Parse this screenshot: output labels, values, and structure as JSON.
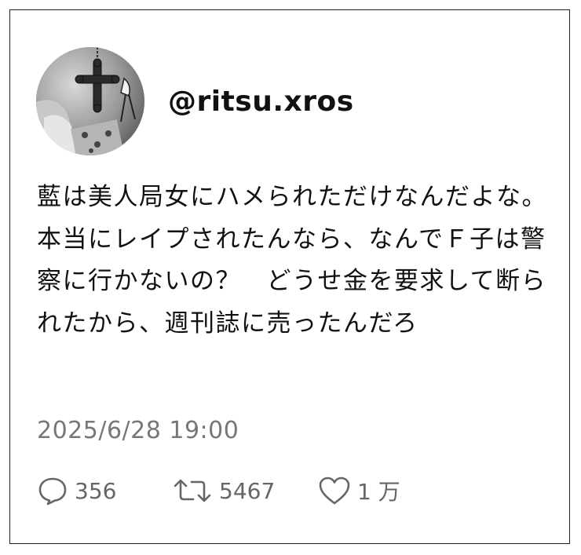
{
  "tweet": {
    "handle": "@ritsu.xros",
    "body": "藍は美人局女にハメられただけなんだよな。本当にレイプされたんなら、なんでＦ子は警察に行かないの？　どうせ金を要求して断られたから、週刊誌に売ったんだろ",
    "timestamp": "2025/6/28  19:00"
  },
  "actions": {
    "reply": {
      "icon": "speech-bubble-icon",
      "count": "356"
    },
    "retweet": {
      "icon": "retweet-icon",
      "count": "5467"
    },
    "like": {
      "icon": "heart-icon",
      "count": "1 万"
    }
  }
}
